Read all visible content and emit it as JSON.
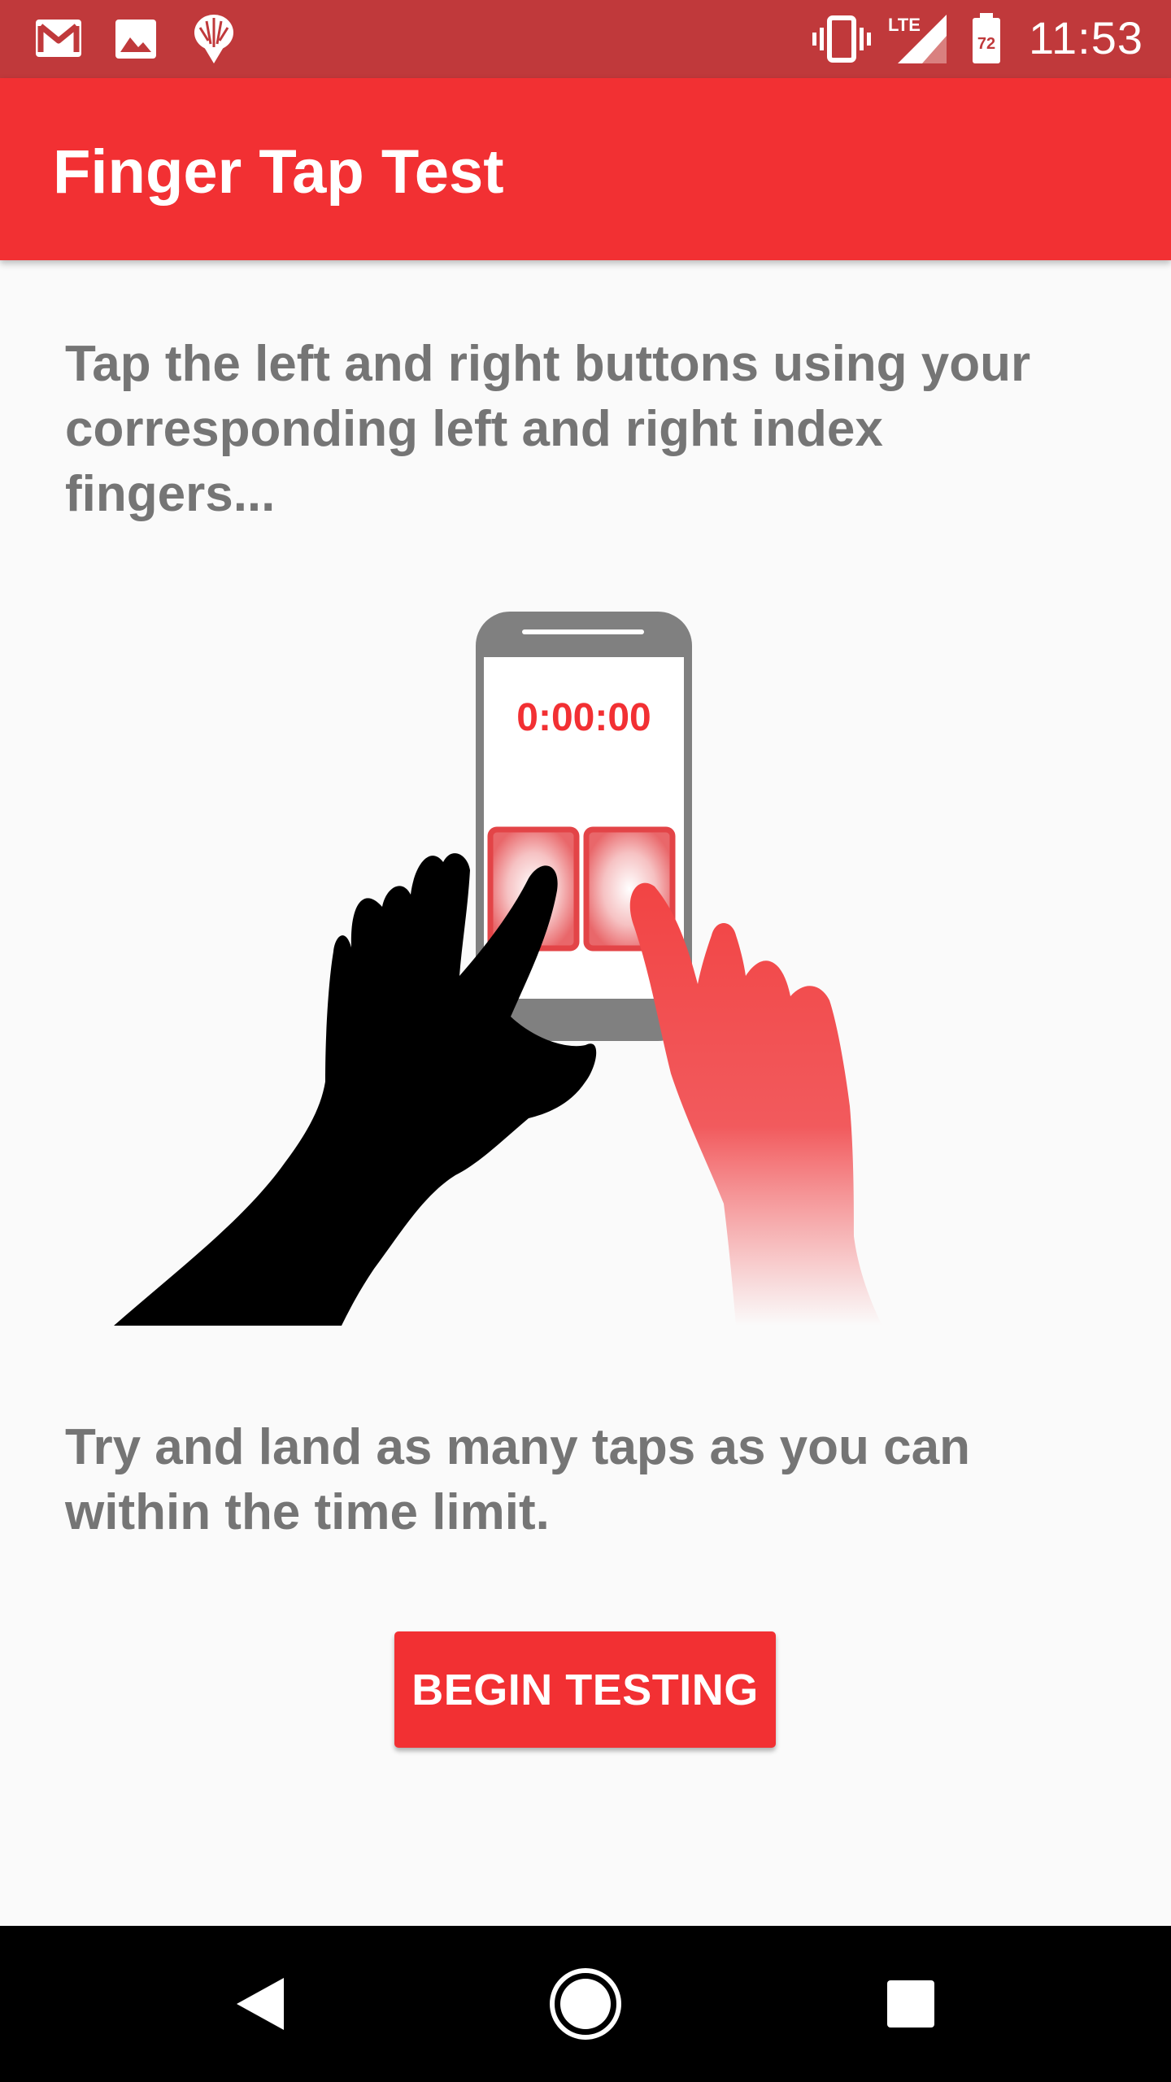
{
  "status_bar": {
    "time": "11:53",
    "battery_level": "72",
    "network": "LTE",
    "icons": [
      "gmail-icon",
      "image-icon",
      "bug-icon",
      "vibrate-icon",
      "lte-signal-icon",
      "battery-icon"
    ]
  },
  "app_bar": {
    "title": "Finger Tap Test"
  },
  "instructions": {
    "top": "Tap the left and right buttons using your corresponding left and right index fingers...",
    "bottom": "Try and land as many taps as you can within the time limit."
  },
  "illustration": {
    "timer": "0:00:00"
  },
  "actions": {
    "begin_label": "BEGIN TESTING"
  },
  "nav_bar": {
    "icons": [
      "back-icon",
      "home-icon",
      "recents-icon"
    ]
  },
  "colors": {
    "accent": "#f23033",
    "status_bar": "#c0393b",
    "text": "#757575",
    "background": "#fafafa"
  }
}
